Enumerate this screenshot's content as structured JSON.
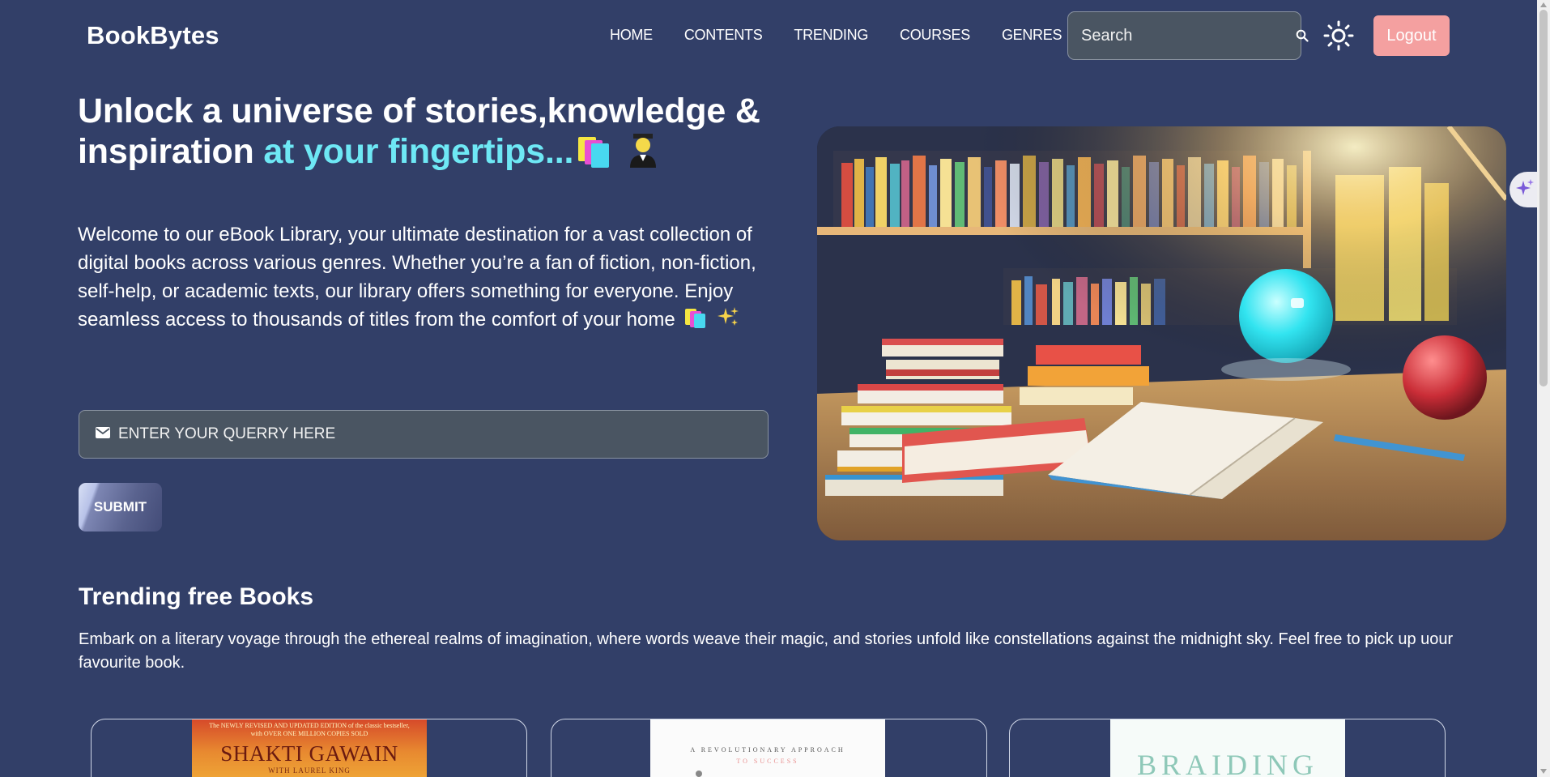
{
  "nav": {
    "brand": "BookBytes",
    "links": [
      "HOME",
      "CONTENTS",
      "TRENDING",
      "COURSES",
      "GENRES"
    ],
    "search_placeholder": "Search",
    "logout_label": "Logout"
  },
  "hero": {
    "title_part1": "Unlock a universe of stories,knowledge & inspiration ",
    "title_accent": "at your fingertips...",
    "description": "Welcome to our eBook Library, your ultimate destination for a vast collection of digital books across various genres. Whether you’re a fan of fiction, non-fiction, self-help, or academic texts, our library offers something for everyone. Enjoy seamless access to thousands of titles from the comfort of your home",
    "query_placeholder": "ENTER YOUR QUERRY HERE",
    "submit_label": "SUBMIT"
  },
  "trending": {
    "title": "Trending free Books",
    "description": "Embark on a literary voyage through the ethereal realms of imagination, where words weave their magic, and stories unfold like constellations against the midnight sky. Feel free to pick up uour favourite book.",
    "books": [
      {
        "cover_top": "The NEWLY REVISED AND UPDATED EDITION of the classic bestseller, with OVER ONE MILLION COPIES SOLD",
        "cover_title": "SHAKTI GAWAIN",
        "cover_sub": "WITH LAUREL KING"
      },
      {
        "cover_top": "A REVOLUTIONARY APPROACH",
        "cover_title": "TO SUCCESS",
        "cover_sub": ""
      },
      {
        "cover_top": "",
        "cover_title": "BRAIDING",
        "cover_sub": ""
      }
    ]
  },
  "colors": {
    "background": "#323f68",
    "accent": "#6ee8f5",
    "logout": "#f4a0a0",
    "input_bg": "#4a5562"
  },
  "icons": [
    "search-icon",
    "sun-icon",
    "mail-icon",
    "books-emoji-icon",
    "student-emoji-icon",
    "sparkles-icon",
    "ai-sparkle-icon"
  ]
}
